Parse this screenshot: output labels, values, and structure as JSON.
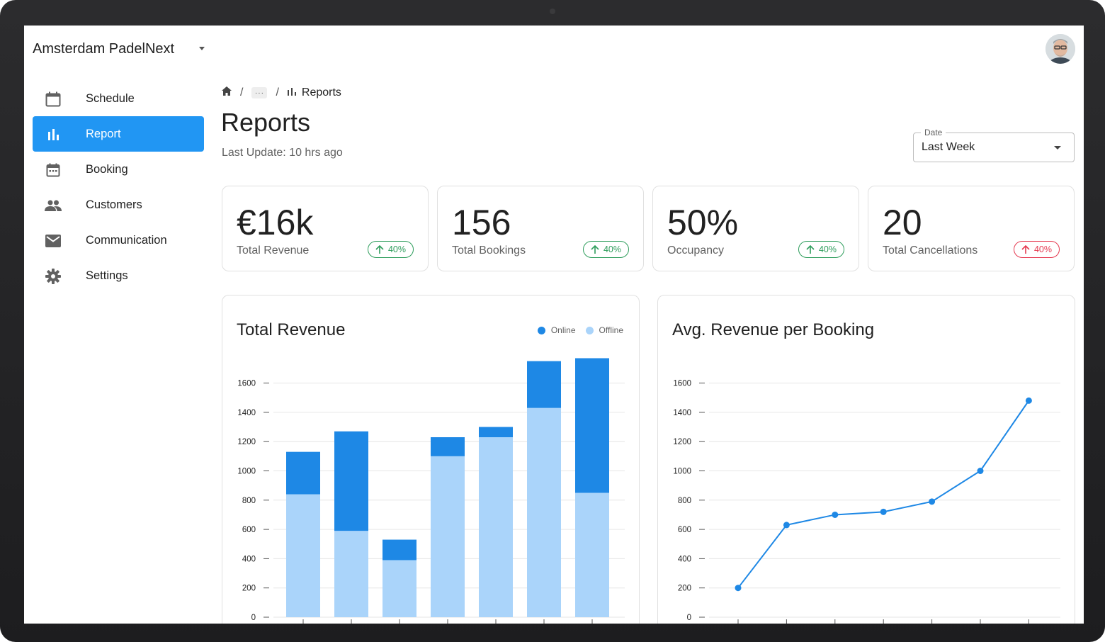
{
  "app": {
    "club_name": "Amsterdam PadelNext"
  },
  "sidebar": {
    "items": [
      {
        "label": "Schedule",
        "icon": "calendar-icon"
      },
      {
        "label": "Report",
        "icon": "bar-chart-icon"
      },
      {
        "label": "Booking",
        "icon": "event-icon"
      },
      {
        "label": "Customers",
        "icon": "people-icon"
      },
      {
        "label": "Communication",
        "icon": "mail-icon"
      },
      {
        "label": "Settings",
        "icon": "gear-icon"
      }
    ],
    "active": "Report"
  },
  "breadcrumb": {
    "more": "···",
    "current": "Reports"
  },
  "header": {
    "title": "Reports",
    "last_update": "Last Update: 10 hrs ago"
  },
  "date_filter": {
    "label": "Date",
    "value": "Last Week"
  },
  "kpis": [
    {
      "value": "€16k",
      "label": "Total Revenue",
      "change": "40%",
      "trend": "up"
    },
    {
      "value": "156",
      "label": "Total Bookings",
      "change": "40%",
      "trend": "up"
    },
    {
      "value": "50%",
      "label": "Occupancy",
      "change": "40%",
      "trend": "up"
    },
    {
      "value": "20",
      "label": "Total Cancellations",
      "change": "40%",
      "trend": "down"
    }
  ],
  "colors": {
    "accent": "#2196f3",
    "online": "#1e88e5",
    "offline": "#aad4fa",
    "up": "#2e9d5c",
    "down": "#e53950"
  },
  "chart_data": [
    {
      "type": "bar",
      "stacked": true,
      "title": "Total Revenue",
      "series": [
        {
          "name": "Offline",
          "values": [
            840,
            590,
            390,
            1100,
            1230,
            1430,
            850
          ]
        },
        {
          "name": "Online",
          "values": [
            290,
            680,
            140,
            130,
            70,
            320,
            920
          ]
        }
      ],
      "legend": [
        "Online",
        "Offline"
      ],
      "legend_position": "top-right",
      "yticks": [
        0,
        200,
        400,
        600,
        800,
        1000,
        1200,
        1400,
        1600
      ],
      "ylim": [
        0,
        1600
      ],
      "grid": true
    },
    {
      "type": "line",
      "title": "Avg. Revenue per Booking",
      "series": [
        {
          "values": [
            200,
            630,
            700,
            720,
            790,
            1000,
            1480
          ]
        }
      ],
      "yticks": [
        0,
        200,
        400,
        600,
        800,
        1000,
        1200,
        1400,
        1600
      ],
      "ylim": [
        0,
        1600
      ],
      "grid": true
    }
  ]
}
